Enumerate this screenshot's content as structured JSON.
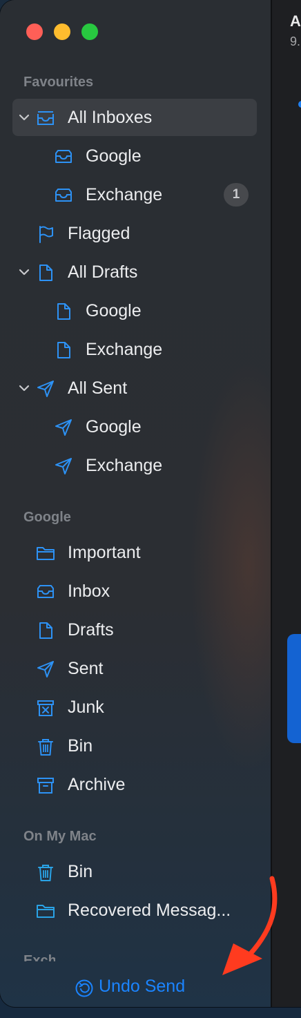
{
  "colors": {
    "accent": "#1b84ff",
    "icon_blue": "#2d92f5",
    "selected_row": "#3b3e43",
    "annotation_arrow": "#ff3b1f"
  },
  "window": {
    "traffic_lights": [
      "close",
      "minimize",
      "zoom"
    ]
  },
  "content_pane": {
    "title_fragment": "A",
    "subtitle_fragment": "9."
  },
  "sidebar": {
    "favourites": {
      "header": "Favourites",
      "items": [
        {
          "label": "All Inboxes",
          "icon": "inbox-tray-icon",
          "expanded": true,
          "selected": true
        },
        {
          "label": "Google",
          "icon": "inbox-tray-icon"
        },
        {
          "label": "Exchange",
          "icon": "inbox-tray-icon",
          "badge": "1"
        },
        {
          "label": "Flagged",
          "icon": "flag-icon"
        },
        {
          "label": "All Drafts",
          "icon": "document-icon",
          "expanded": true
        },
        {
          "label": "Google",
          "icon": "document-icon"
        },
        {
          "label": "Exchange",
          "icon": "document-icon"
        },
        {
          "label": "All Sent",
          "icon": "paper-plane-icon",
          "expanded": true
        },
        {
          "label": "Google",
          "icon": "paper-plane-icon"
        },
        {
          "label": "Exchange",
          "icon": "paper-plane-icon"
        }
      ]
    },
    "google": {
      "header": "Google",
      "items": [
        {
          "label": "Important",
          "icon": "folder-icon"
        },
        {
          "label": "Inbox",
          "icon": "inbox-tray-icon"
        },
        {
          "label": "Drafts",
          "icon": "document-icon"
        },
        {
          "label": "Sent",
          "icon": "paper-plane-icon"
        },
        {
          "label": "Junk",
          "icon": "junk-icon"
        },
        {
          "label": "Bin",
          "icon": "trash-icon"
        },
        {
          "label": "Archive",
          "icon": "archive-box-icon"
        }
      ]
    },
    "on_my_mac": {
      "header": "On My Mac",
      "items": [
        {
          "label": "Bin",
          "icon": "trash-icon"
        },
        {
          "label": "Recovered Messag...",
          "icon": "folder-icon"
        }
      ]
    },
    "next_section_header_partial": "Exch"
  },
  "footer": {
    "undo_send_label": "Undo Send",
    "undo_icon": "undo-circle-icon"
  }
}
